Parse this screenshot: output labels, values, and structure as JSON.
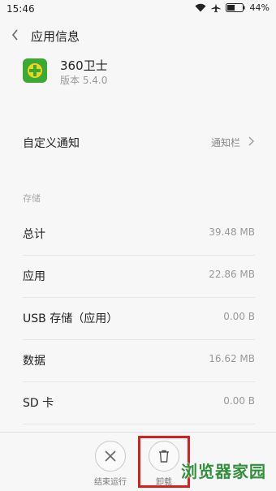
{
  "status_bar": {
    "time": "15:46",
    "battery": "44%"
  },
  "app_bar": {
    "title": "应用信息"
  },
  "app": {
    "name": "360卫士",
    "version": "版本 5.4.0",
    "icon_color": "#3aa935"
  },
  "notification": {
    "label": "自定义通知",
    "value": "通知栏"
  },
  "storage": {
    "section_label": "存储",
    "rows": [
      {
        "label": "总计",
        "value": "39.48 MB"
      },
      {
        "label": "应用",
        "value": "22.86 MB"
      },
      {
        "label": "USB 存储（应用）",
        "value": "0.00 B"
      },
      {
        "label": "数据",
        "value": "16.62 MB"
      },
      {
        "label": "SD 卡",
        "value": "0.00 B"
      }
    ]
  },
  "actions": {
    "force_stop": "结束运行",
    "uninstall": "卸载"
  },
  "watermark": "浏览器家园"
}
